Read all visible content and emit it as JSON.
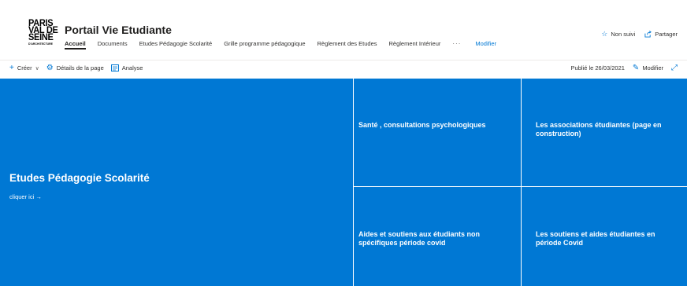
{
  "logo": {
    "line1": "PARIS",
    "line2": "VAL DE",
    "line3": "SEINE",
    "line4": "D'ARCHITECTURE"
  },
  "site": {
    "title": "Portail Vie Etudiante"
  },
  "nav": {
    "items": [
      {
        "label": "Accueil",
        "active": true
      },
      {
        "label": "Documents"
      },
      {
        "label": "Etudes Pédagogie Scolarité"
      },
      {
        "label": "Grille programme pédagogique"
      },
      {
        "label": "Règlement des Etudes"
      },
      {
        "label": "Règlement Intérieur"
      }
    ],
    "more": "···",
    "edit": "Modifier"
  },
  "header_actions": {
    "follow": "Non suivi",
    "follow_icon": "star-icon",
    "share": "Partager",
    "share_icon": "share-icon"
  },
  "commandbar": {
    "create": "Créer",
    "details": "Détails de la page",
    "analytics": "Analyse",
    "published": "Publié le 26/03/2021",
    "edit": "Modifier"
  },
  "hero": {
    "main": {
      "title": "Etudes Pédagogie Scolarité",
      "link": "cliquer ici →"
    },
    "tiles": [
      {
        "title": "Santé , consultations psychologiques"
      },
      {
        "title": "Les associations étudiantes (page en construction)"
      },
      {
        "title": "Aides et soutiens aux étudiants non spécifiques période covid"
      },
      {
        "title": "Les soutiens et aides étudiantes en période Covid"
      }
    ]
  },
  "colors": {
    "accent": "#0078d4",
    "tile": "#0078d4",
    "text": "#323130"
  }
}
